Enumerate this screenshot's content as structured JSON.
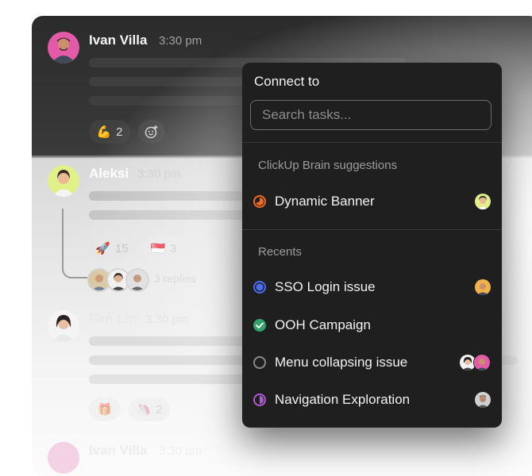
{
  "messages": [
    {
      "name": "Ivan Villa",
      "time": "3:30 pm",
      "reactions": [
        {
          "emoji": "💪",
          "count": "2"
        }
      ]
    },
    {
      "name": "Aleksi",
      "time": "3:30 pm",
      "reactions": [
        {
          "emoji": "🚀",
          "count": "15"
        },
        {
          "emoji": "🇸🇬",
          "count": "3"
        }
      ],
      "thread_meta": "3 replies"
    },
    {
      "name": "Fan Lin",
      "time": "3:30 pm",
      "reactions": [
        {
          "emoji": "🎁",
          "count": ""
        },
        {
          "emoji": "🦄",
          "count": "2"
        }
      ]
    },
    {
      "name": "Ivan Villa",
      "time": "3:30 pm"
    }
  ],
  "dropdown": {
    "title": "Connect to",
    "search_placeholder": "Search tasks...",
    "section_suggestions": "ClickUp Brain suggestions",
    "section_recents": "Recents",
    "suggestions": [
      {
        "label": "Dynamic Banner",
        "status_color": "#f26a1b",
        "status": "in-progress"
      }
    ],
    "recents": [
      {
        "label": "SSO Login issue",
        "status_color": "#4a6cf7",
        "status": "in-review"
      },
      {
        "label": "OOH Campaign",
        "status_color": "#2fa36b",
        "status": "complete"
      },
      {
        "label": "Menu collapsing issue",
        "status_color": "#8a8a8a",
        "status": "to-do"
      },
      {
        "label": "Navigation Exploration",
        "status_color": "#b15bd6",
        "status": "in-progress"
      }
    ]
  },
  "colors": {
    "dark_panel": "#2b2b2b",
    "dropdown_bg": "#1f1f1f"
  }
}
